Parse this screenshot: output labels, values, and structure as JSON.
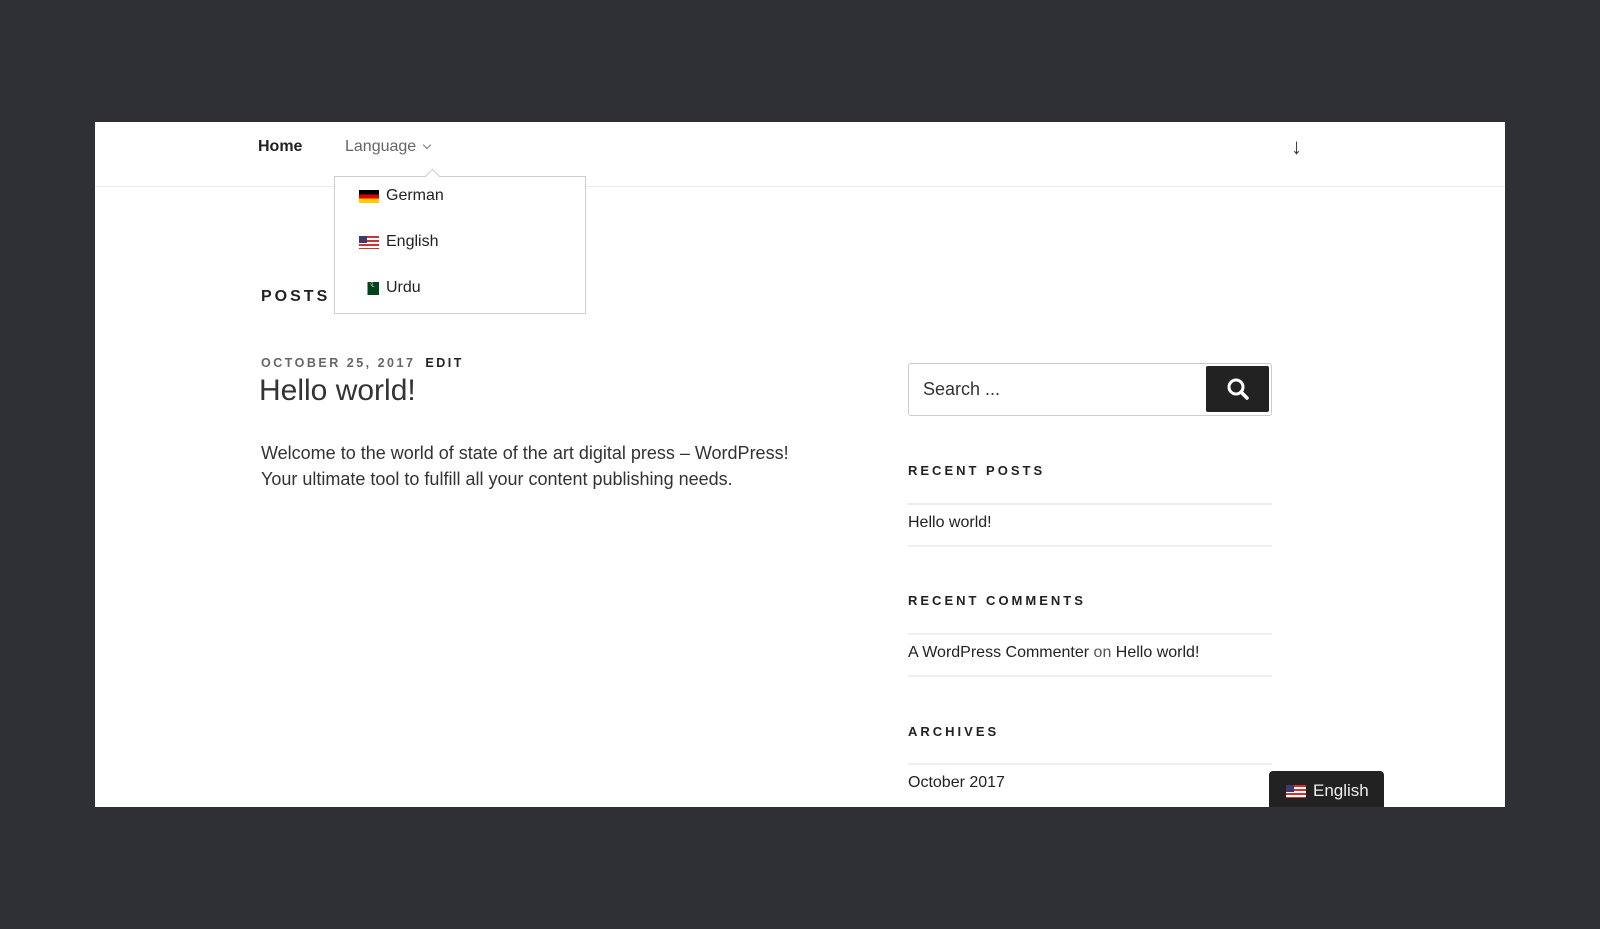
{
  "nav": {
    "home": "Home",
    "language": "Language",
    "scroll_icon": "arrow-down-icon"
  },
  "dropdown": {
    "items": [
      {
        "label": "German",
        "flag": "de"
      },
      {
        "label": "English",
        "flag": "us"
      },
      {
        "label": "Urdu",
        "flag": "pk"
      }
    ]
  },
  "main": {
    "section_title": "POSTS",
    "post": {
      "date": "OCTOBER 25, 2017",
      "edit": "EDIT",
      "title": "Hello world!",
      "body_line1": "Welcome to the world of state of the art digital press – WordPress!",
      "body_line2": "Your ultimate tool to fulfill all your content publishing needs."
    }
  },
  "sidebar": {
    "search": {
      "placeholder": "Search ...",
      "icon": "search-icon"
    },
    "recent_posts": {
      "title": "RECENT POSTS",
      "items": [
        "Hello world!"
      ]
    },
    "recent_comments": {
      "title": "RECENT COMMENTS",
      "author": "A WordPress Commenter",
      "on": "on",
      "post": "Hello world!"
    },
    "archives": {
      "title": "ARCHIVES",
      "items": [
        "October 2017"
      ]
    }
  },
  "language_switcher": {
    "label": "English",
    "flag": "us"
  },
  "colors": {
    "background": "#2f3034",
    "button": "#222222"
  }
}
